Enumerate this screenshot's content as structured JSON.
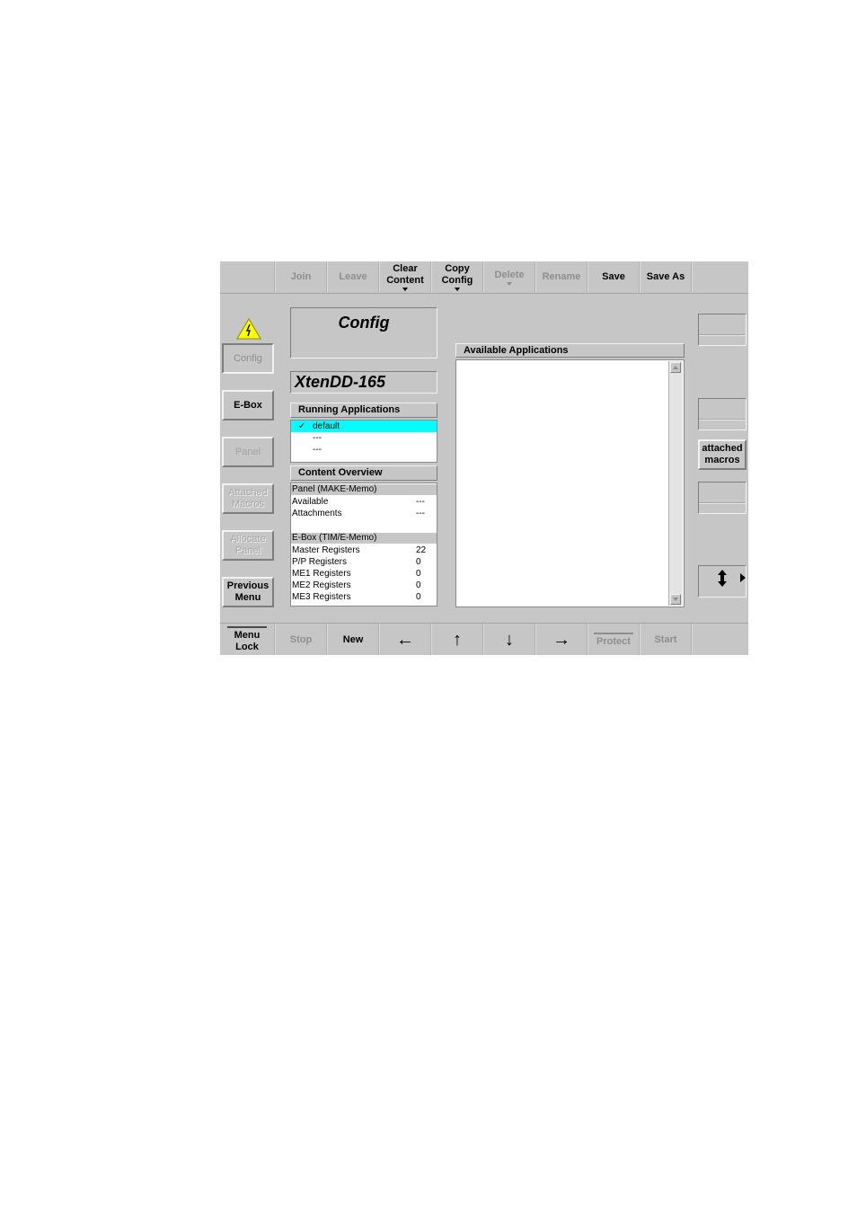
{
  "toolbar_top": {
    "join": "Join",
    "leave": "Leave",
    "clear_content": [
      "Clear",
      "Content"
    ],
    "copy_config": [
      "Copy",
      "Config"
    ],
    "delete": "Delete",
    "rename": "Rename",
    "save": "Save",
    "save_as": "Save As"
  },
  "left_nav": {
    "config": "Config",
    "ebox": "E-Box",
    "panel": "Panel",
    "attached_macros": [
      "Attached",
      "Macros"
    ],
    "allocate_panel": [
      "Allocate",
      "Panel"
    ],
    "previous_menu": [
      "Previous",
      "Menu"
    ]
  },
  "main": {
    "title": "Config",
    "device_name": "XtenDD-165",
    "running_header": "Running Applications",
    "running_items": [
      {
        "check": "✓",
        "label": "default"
      },
      {
        "check": "",
        "label": "---"
      },
      {
        "check": "",
        "label": "---"
      }
    ],
    "overview_header": "Content Overview",
    "panel_section": {
      "title": "Panel (MAKE-Memo)",
      "rows": [
        {
          "key": "Available",
          "value": "---"
        },
        {
          "key": "Attachments",
          "value": "---"
        }
      ]
    },
    "ebox_section": {
      "title": "E-Box (TIM/E-Memo)",
      "rows": [
        {
          "key": "Master Registers",
          "value": "22"
        },
        {
          "key": "P/P Registers",
          "value": "0"
        },
        {
          "key": "ME1 Registers",
          "value": "0"
        },
        {
          "key": "ME2 Registers",
          "value": "0"
        },
        {
          "key": "ME3 Registers",
          "value": "0"
        }
      ]
    },
    "available_header": "Available Applications"
  },
  "right_col": {
    "attached_macros": [
      "attached",
      "macros"
    ]
  },
  "toolbar_bottom": {
    "menu_lock": [
      "Menu",
      "Lock"
    ],
    "stop": "Stop",
    "new": "New",
    "left": "←",
    "up": "↑",
    "down": "↓",
    "right": "→",
    "protect": "Protect",
    "start": "Start"
  },
  "colors": {
    "background": "#c6c6c6",
    "selection": "#00ffff",
    "warning": "#ffff00"
  }
}
